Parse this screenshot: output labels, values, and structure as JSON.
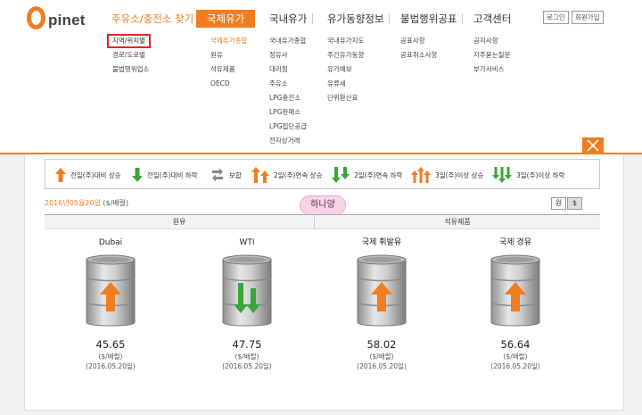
{
  "logo": {
    "text": "pinet",
    "brand_color": "#f07d1f"
  },
  "nav": {
    "items": [
      {
        "label": "주유소/충전소 찾기"
      },
      {
        "label": "국제유가"
      },
      {
        "label": "국내유가"
      },
      {
        "label": "유가동향정보"
      },
      {
        "label": "불법행위공표"
      },
      {
        "label": "고객센터"
      }
    ],
    "login_label": "로그인",
    "signup_label": "회원가입"
  },
  "submenu": {
    "col1": [
      "지역/위치별",
      "경로/도로별",
      "불법행위업소"
    ],
    "col2": [
      "국제유가종합",
      "원유",
      "석유제품",
      "OECD"
    ],
    "col3": [
      "국내유가종합",
      "정유사",
      "대리점",
      "주유소",
      "LPG충전소",
      "LPG판매소",
      "LPG집단공급",
      "전자상거래"
    ],
    "col4": [
      "국내유가지도",
      "주간유가동향",
      "유가예보",
      "유류세",
      "단위환산표"
    ],
    "col5": [
      "공표사항",
      "공표취소사항"
    ],
    "col6": [
      "공지사항",
      "자주묻는질문",
      "부가서비스"
    ]
  },
  "legend": [
    {
      "label": "전일(주)대비 상승",
      "icon": "arrow-up-icon"
    },
    {
      "label": "전일(주)대비 하락",
      "icon": "arrow-down-icon"
    },
    {
      "label": "보합",
      "icon": "refresh-icon"
    },
    {
      "label": "2일(주)연속 상승",
      "icon": "double-arrow-up-icon"
    },
    {
      "label": "2일(주)연속 하락",
      "icon": "double-arrow-down-icon"
    },
    {
      "label": "3일(주)이상 상승",
      "icon": "triple-arrow-up-icon"
    },
    {
      "label": "3일(주)이상 하락",
      "icon": "triple-arrow-down-icon"
    }
  ],
  "date": {
    "value": "2016년05월20일",
    "unit": "($/배럴)"
  },
  "unit_toggle": {
    "won": "원",
    "dollar": "$"
  },
  "stamp": "하나양",
  "table": {
    "header_left": "원유",
    "header_right": "석유제품"
  },
  "prices": [
    {
      "name": "Dubai",
      "price": "45.65",
      "unit": "($/배럴)",
      "date": "(2016.05.20일)",
      "trend": "up"
    },
    {
      "name": "WTI",
      "price": "47.75",
      "unit": "($/배럴)",
      "date": "(2016.05.20일)",
      "trend": "double-down"
    },
    {
      "name": "국제 휘발유",
      "price": "58.02",
      "unit": "($/배럴)",
      "date": "(2016.05.20일)",
      "trend": "up"
    },
    {
      "name": "국제 경유",
      "price": "56.64",
      "unit": "($/배럴)",
      "date": "(2016.05.20일)",
      "trend": "up"
    }
  ],
  "colors": {
    "accent": "#f07d1f",
    "up": "#f07d1f",
    "down": "#3aa53a",
    "highlight_box": "#e0262b"
  }
}
